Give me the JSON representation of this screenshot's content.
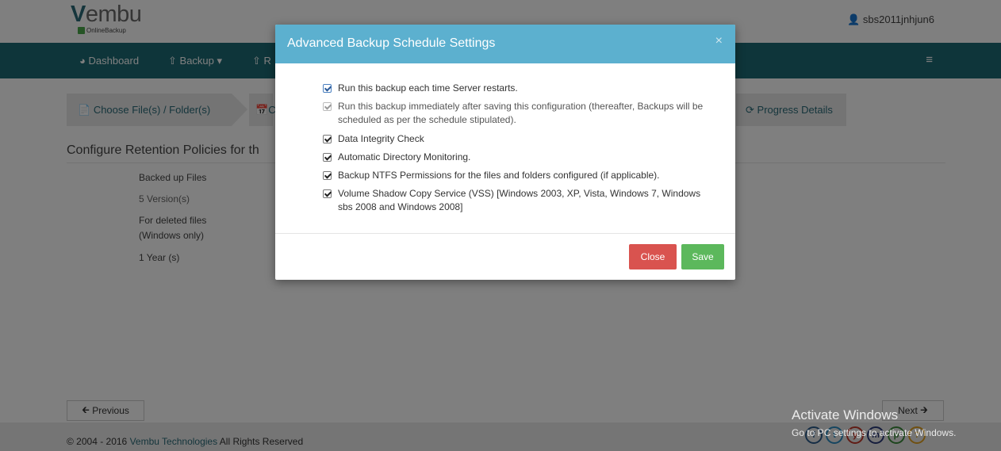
{
  "header": {
    "logo_text": "embu",
    "logo_v": "V",
    "logo_sub": "OnlineBackup",
    "user_icon": "user-icon",
    "username": "sbs2011jnhjun6"
  },
  "nav": {
    "items": [
      {
        "icon": "dashboard-icon",
        "label": "Dashboard"
      },
      {
        "icon": "upload-icon",
        "label": "Backup"
      },
      {
        "icon": "restore-icon",
        "label": "R"
      }
    ],
    "menu_icon": "hamburger-icon"
  },
  "steps": {
    "step1": "Choose File(s) / Folder(s)",
    "step2": "C",
    "progress": "Progress Details"
  },
  "retention": {
    "title": "Configure Retention Policies for th",
    "backed_up_label": "Backed up Files",
    "backed_up_value": "5 Version(s)",
    "deleted_label_1": "For deleted files",
    "deleted_label_2": "(Windows only)",
    "deleted_value": "1 Year (s)"
  },
  "footer": {
    "prev": "Previous",
    "next": "Next",
    "copyright": "© 2004 - 2016",
    "company": "Vembu Technologies",
    "rights": "All Rights Reserved",
    "social": [
      "f",
      "t",
      "y",
      "m",
      "p",
      "?"
    ]
  },
  "watermark": {
    "line1": "Activate Windows",
    "line2": "Go to PC settings to activate Windows."
  },
  "modal": {
    "title": "Advanced Backup Schedule Settings",
    "close_x": "×",
    "options": [
      "Run this backup each time Server restarts.",
      "Run this backup immediately after saving this configuration (thereafter, Backups will be scheduled as per the schedule stipulated).",
      "Data Integrity Check",
      "Automatic Directory Monitoring.",
      "Backup NTFS Permissions for the files and folders configured (if applicable).",
      "Volume Shadow Copy Service (VSS) [Windows 2003, XP, Vista, Windows 7, Windows sbs 2008 and Windows 2008]"
    ],
    "close_label": "Close",
    "save_label": "Save"
  }
}
